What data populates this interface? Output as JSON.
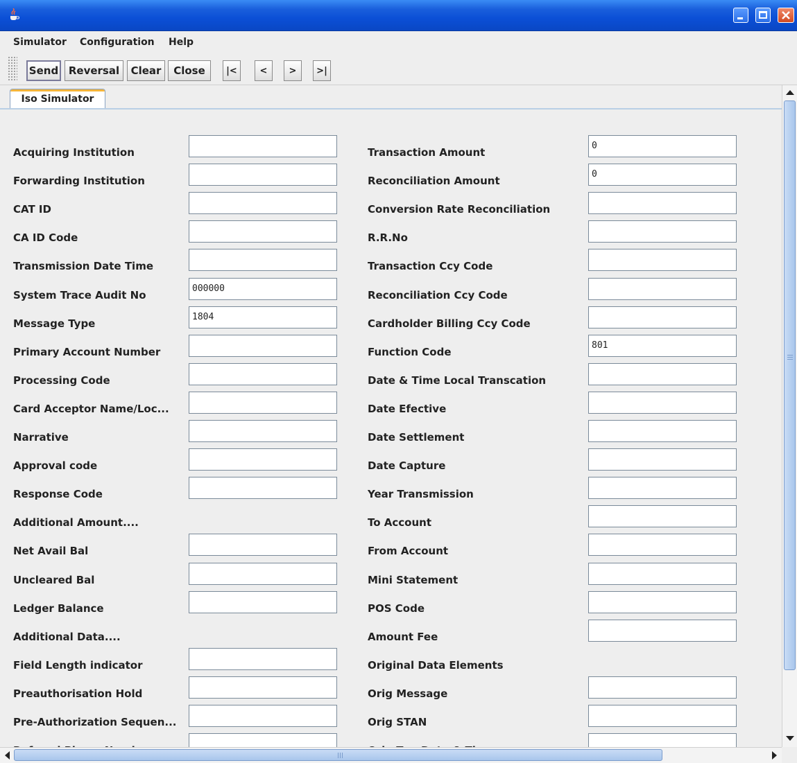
{
  "window": {
    "title": "",
    "icon": "java-coffee-cup-icon",
    "controls": [
      "minimize-icon",
      "maximize-icon",
      "close-icon"
    ]
  },
  "menubar": {
    "items": [
      "Simulator",
      "Configuration",
      "Help"
    ]
  },
  "toolbar": {
    "send": "Send",
    "reversal": "Reversal",
    "clear": "Clear",
    "close": "Close",
    "first": "|<",
    "prev": "<",
    "next": ">",
    "last": ">|"
  },
  "tabs": [
    {
      "label": "Iso Simulator",
      "selected": true
    }
  ],
  "form": {
    "left": [
      {
        "label": "Acquiring Institution",
        "value": ""
      },
      {
        "label": "Forwarding Institution",
        "value": ""
      },
      {
        "label": "CAT ID",
        "value": ""
      },
      {
        "label": "CA ID Code",
        "value": ""
      },
      {
        "label": "Transmission Date Time",
        "value": ""
      },
      {
        "label": "System Trace Audit No",
        "value": "000000"
      },
      {
        "label": "Message Type",
        "value": "1804"
      },
      {
        "label": "Primary Account Number",
        "value": ""
      },
      {
        "label": "Processing Code",
        "value": ""
      },
      {
        "label": "Card Acceptor Name/Loc...",
        "value": ""
      },
      {
        "label": "Narrative",
        "value": ""
      },
      {
        "label": "Approval code",
        "value": ""
      },
      {
        "label": "Response Code",
        "value": ""
      },
      {
        "label": "Additional Amount....",
        "value": null
      },
      {
        "label": "Net Avail Bal",
        "value": ""
      },
      {
        "label": "Uncleared Bal",
        "value": ""
      },
      {
        "label": "Ledger Balance",
        "value": ""
      },
      {
        "label": "Additional Data....",
        "value": null
      },
      {
        "label": "Field Length indicator",
        "value": ""
      },
      {
        "label": "Preauthorisation Hold",
        "value": ""
      },
      {
        "label": "Pre-Authorization Sequen...",
        "value": ""
      },
      {
        "label": "Referral Phone Number",
        "value": ""
      }
    ],
    "right": [
      {
        "label": "Transaction Amount",
        "value": "0"
      },
      {
        "label": "Reconciliation Amount",
        "value": "0"
      },
      {
        "label": "Conversion Rate Reconciliation",
        "value": ""
      },
      {
        "label": "R.R.No",
        "value": ""
      },
      {
        "label": "Transaction Ccy Code",
        "value": ""
      },
      {
        "label": "Reconciliation Ccy Code",
        "value": ""
      },
      {
        "label": "Cardholder Billing Ccy Code",
        "value": ""
      },
      {
        "label": "Function Code",
        "value": "801"
      },
      {
        "label": "Date & Time Local Transcation",
        "value": ""
      },
      {
        "label": "Date Efective",
        "value": ""
      },
      {
        "label": "Date Settlement",
        "value": ""
      },
      {
        "label": "Date Capture",
        "value": ""
      },
      {
        "label": "Year Transmission",
        "value": ""
      },
      {
        "label": "To Account",
        "value": ""
      },
      {
        "label": "From Account",
        "value": ""
      },
      {
        "label": "Mini Statement",
        "value": ""
      },
      {
        "label": "POS Code",
        "value": ""
      },
      {
        "label": "Amount Fee",
        "value": ""
      },
      {
        "label": "Original Data Elements",
        "value": null
      },
      {
        "label": "Orig Message",
        "value": ""
      },
      {
        "label": "Orig STAN",
        "value": ""
      },
      {
        "label": "Orig Txn Date & Time",
        "value": ""
      }
    ]
  }
}
